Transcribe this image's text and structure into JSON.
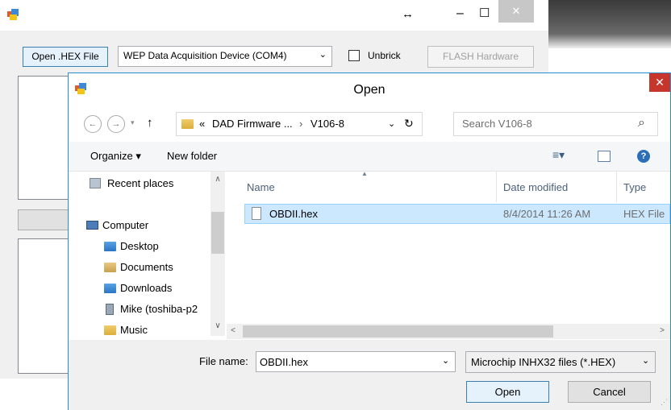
{
  "main_window": {
    "open_hex_button": "Open .HEX File",
    "device_select": "WEP Data Acquisition Device (COM4)",
    "unbrick_label": "Unbrick",
    "flash_button": "FLASH Hardware",
    "title_controls": {
      "move": "↔",
      "minimize": "–",
      "maximize": "☐",
      "close": "✕"
    }
  },
  "dialog": {
    "title": "Open",
    "close": "✕",
    "nav": {
      "back": "←",
      "forward": "→",
      "up": "↑",
      "path_prefix": "«",
      "path_parts": [
        "DAD Firmware ...",
        "V106-8"
      ],
      "path_sep": "›",
      "refresh": "↻",
      "search_placeholder": "Search V106-8",
      "search_icon": "⌕"
    },
    "toolbar": {
      "organize": "Organize ▾",
      "new_folder": "New folder",
      "view_icon": "≡▾",
      "help": "?"
    },
    "nav_pane": {
      "items": [
        {
          "label": "Recent places",
          "icon": "recent-places-icon"
        },
        {
          "label": "Computer",
          "icon": "computer-icon"
        },
        {
          "label": "Desktop",
          "icon": "desktop-folder-icon"
        },
        {
          "label": "Documents",
          "icon": "documents-folder-icon"
        },
        {
          "label": "Downloads",
          "icon": "downloads-folder-icon"
        },
        {
          "label": "Mike (toshiba-p2",
          "icon": "network-drive-icon"
        },
        {
          "label": "Music",
          "icon": "music-folder-icon"
        }
      ]
    },
    "file_list": {
      "columns": {
        "name": "Name",
        "date": "Date modified",
        "type": "Type"
      },
      "rows": [
        {
          "name": "OBDII.hex",
          "date": "8/4/2014 11:26 AM",
          "type": "HEX File"
        }
      ]
    },
    "bottom": {
      "file_name_label": "File name:",
      "file_name_value": "OBDII.hex",
      "filter": "Microchip INHX32 files (*.HEX)",
      "open_button": "Open",
      "cancel_button": "Cancel"
    }
  },
  "colors": {
    "selection": "#cce8ff",
    "dialog_border": "#2a8dd4",
    "close_red": "#c7362d"
  }
}
